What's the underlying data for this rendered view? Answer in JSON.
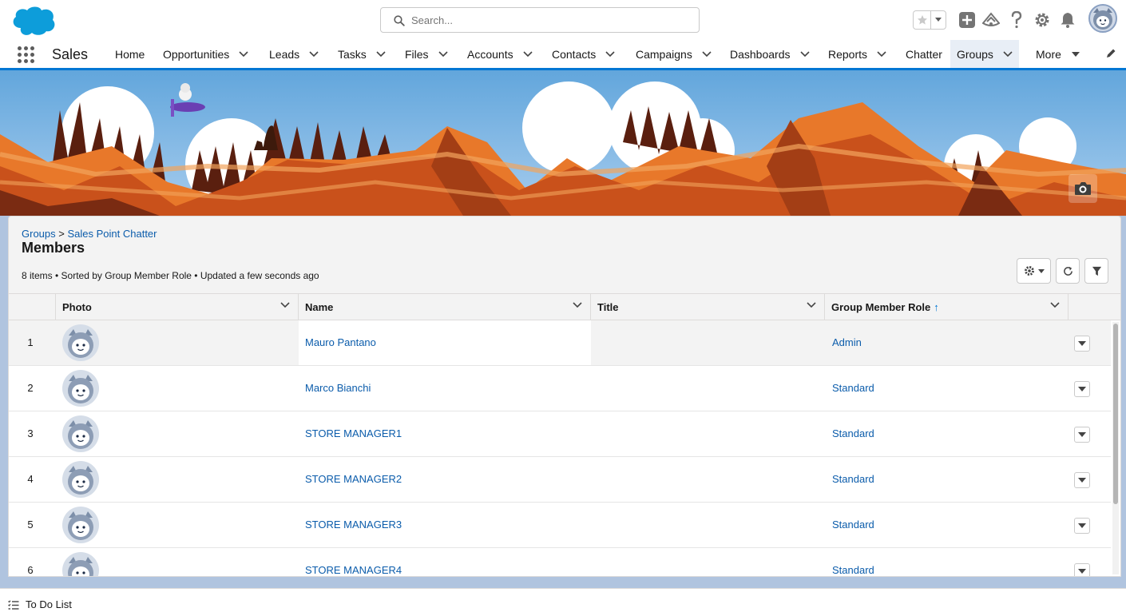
{
  "brand": {
    "accent": "#0176d3",
    "link": "#0b5cab",
    "logo": "salesforce-cloud-logo"
  },
  "search": {
    "placeholder": "Search..."
  },
  "header_icons": [
    "favorites-star-icon",
    "favorites-dropdown-icon",
    "global-actions-plus-icon",
    "trailhead-guide-icon",
    "help-icon",
    "setup-gear-icon",
    "notifications-bell-icon",
    "user-avatar"
  ],
  "nav": {
    "app_name": "Sales",
    "items": [
      {
        "label": "Home",
        "has_menu": false
      },
      {
        "label": "Opportunities",
        "has_menu": true
      },
      {
        "label": "Leads",
        "has_menu": true
      },
      {
        "label": "Tasks",
        "has_menu": true
      },
      {
        "label": "Files",
        "has_menu": true
      },
      {
        "label": "Accounts",
        "has_menu": true
      },
      {
        "label": "Contacts",
        "has_menu": true
      },
      {
        "label": "Campaigns",
        "has_menu": true
      },
      {
        "label": "Dashboards",
        "has_menu": true
      },
      {
        "label": "Reports",
        "has_menu": true
      },
      {
        "label": "Chatter",
        "has_menu": false
      },
      {
        "label": "Groups",
        "has_menu": true,
        "active": true
      },
      {
        "label": "More",
        "has_menu": true
      }
    ]
  },
  "breadcrumb": {
    "parent": "Groups",
    "separator": ">",
    "current": "Sales Point Chatter"
  },
  "page": {
    "title": "Members",
    "meta": "8 items • Sorted by Group Member Role • Updated a few seconds ago"
  },
  "table": {
    "columns": [
      {
        "label": "Photo"
      },
      {
        "label": "Name"
      },
      {
        "label": "Title"
      },
      {
        "label": "Group Member Role",
        "sort": "↑"
      }
    ],
    "rows": [
      {
        "num": "1",
        "name": "Mauro Pantano",
        "title": "",
        "role": "Admin"
      },
      {
        "num": "2",
        "name": "Marco Bianchi",
        "title": "",
        "role": "Standard"
      },
      {
        "num": "3",
        "name": "STORE MANAGER1",
        "title": "",
        "role": "Standard"
      },
      {
        "num": "4",
        "name": "STORE MANAGER2",
        "title": "",
        "role": "Standard"
      },
      {
        "num": "5",
        "name": "STORE MANAGER3",
        "title": "",
        "role": "Standard"
      },
      {
        "num": "6",
        "name": "STORE MANAGER4",
        "title": "",
        "role": "Standard"
      }
    ]
  },
  "utility": {
    "todo_label": "To Do List"
  }
}
